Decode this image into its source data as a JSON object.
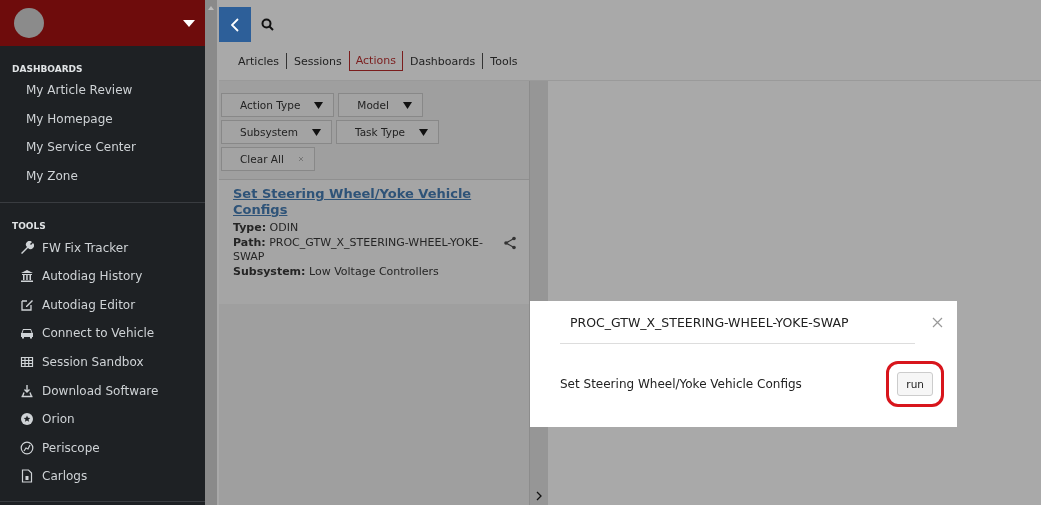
{
  "sidebar": {
    "sections": [
      {
        "heading": "DASHBOARDS",
        "items": [
          {
            "label": "My Article Review"
          },
          {
            "label": "My Homepage"
          },
          {
            "label": "My Service Center"
          },
          {
            "label": "My Zone"
          }
        ]
      },
      {
        "heading": "TOOLS",
        "items": [
          {
            "label": "FW Fix Tracker"
          },
          {
            "label": "Autodiag History"
          },
          {
            "label": "Autodiag Editor"
          },
          {
            "label": "Connect to Vehicle"
          },
          {
            "label": "Session Sandbox"
          },
          {
            "label": "Download Software"
          },
          {
            "label": "Orion"
          },
          {
            "label": "Periscope"
          },
          {
            "label": "Carlogs"
          }
        ]
      }
    ]
  },
  "tabs": [
    {
      "label": "Articles",
      "selected": false
    },
    {
      "label": "Sessions",
      "selected": false
    },
    {
      "label": "Actions",
      "selected": true
    },
    {
      "label": "Dashboards",
      "selected": false
    },
    {
      "label": "Tools",
      "selected": false
    }
  ],
  "filters": [
    {
      "label": "Action Type",
      "kind": "dropdown"
    },
    {
      "label": "Model",
      "kind": "dropdown"
    },
    {
      "label": "Subsystem",
      "kind": "dropdown"
    },
    {
      "label": "Task Type",
      "kind": "dropdown"
    },
    {
      "label": "Clear All",
      "kind": "clear"
    }
  ],
  "result": {
    "title": "Set Steering Wheel/Yoke Vehicle Configs",
    "fields": [
      {
        "label": "Type:",
        "value": "ODIN"
      },
      {
        "label": "Path:",
        "value": "PROC_GTW_X_STEERING-WHEEL-YOKE-SWAP"
      },
      {
        "label": "Subsystem:",
        "value": "Low Voltage Controllers"
      }
    ]
  },
  "dialog": {
    "title": "PROC_GTW_X_STEERING-WHEEL-YOKE-SWAP",
    "message": "Set Steering Wheel/Yoke Vehicle Configs",
    "button": {
      "label": "run",
      "highlighted": true
    }
  }
}
